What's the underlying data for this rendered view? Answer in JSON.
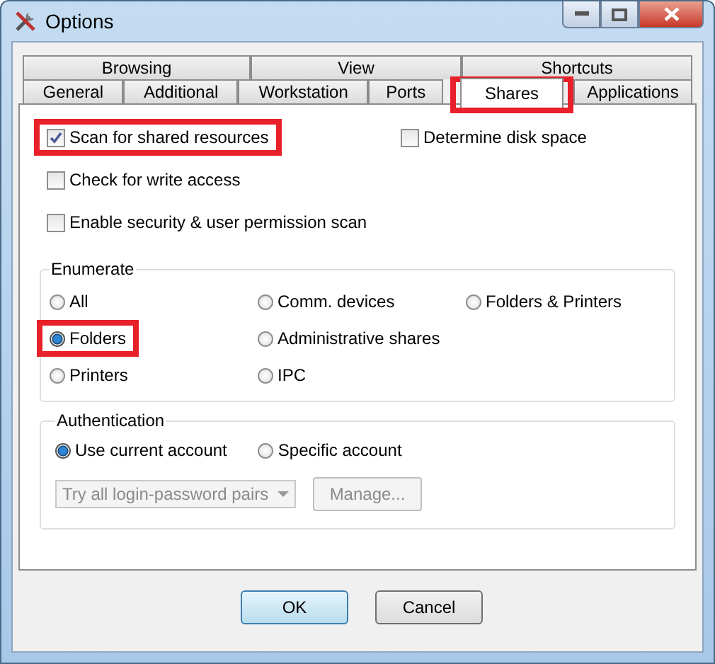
{
  "window": {
    "title": "Options"
  },
  "tab_rows": [
    [
      {
        "label": "Browsing",
        "selected": false
      },
      {
        "label": "View",
        "selected": false
      },
      {
        "label": "Shortcuts",
        "selected": false
      }
    ],
    [
      {
        "label": "General",
        "selected": false
      },
      {
        "label": "Additional",
        "selected": false
      },
      {
        "label": "Workstation",
        "selected": false
      },
      {
        "label": "Ports",
        "selected": false
      },
      {
        "label": "Shares",
        "selected": true,
        "highlighted": true
      },
      {
        "label": "Applications",
        "selected": false
      }
    ]
  ],
  "checkboxes": [
    {
      "label": "Scan for shared resources",
      "checked": true,
      "highlighted": true
    },
    {
      "label": "Determine disk space",
      "checked": false,
      "highlighted": false
    },
    {
      "label": "Check for write access",
      "checked": false,
      "highlighted": false
    },
    {
      "label": "Enable security & user permission scan",
      "checked": false,
      "highlighted": false
    }
  ],
  "enumerate": {
    "title": "Enumerate",
    "options": [
      {
        "label": "All",
        "selected": false,
        "highlighted": false
      },
      {
        "label": "Comm. devices",
        "selected": false,
        "highlighted": false
      },
      {
        "label": "Folders & Printers",
        "selected": false,
        "highlighted": false
      },
      {
        "label": "Folders",
        "selected": true,
        "highlighted": true
      },
      {
        "label": "Administrative shares",
        "selected": false,
        "highlighted": false
      },
      {
        "label": "Printers",
        "selected": false,
        "highlighted": false
      },
      {
        "label": "IPC",
        "selected": false,
        "highlighted": false
      }
    ]
  },
  "authentication": {
    "title": "Authentication",
    "options": [
      {
        "label": "Use current account",
        "selected": true
      },
      {
        "label": "Specific account",
        "selected": false
      }
    ],
    "dropdown": {
      "value": "Try all login-password pairs",
      "disabled": true
    },
    "manage_button": {
      "label": "Manage...",
      "disabled": true
    }
  },
  "buttons": [
    {
      "label": "OK",
      "default": true
    },
    {
      "label": "Cancel",
      "default": false
    }
  ]
}
